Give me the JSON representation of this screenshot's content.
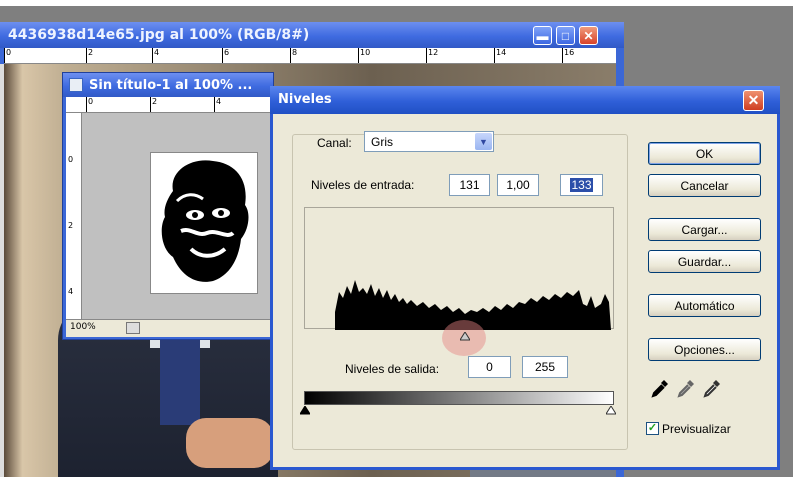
{
  "doc_main": {
    "title": "4436938d14e65.jpg al 100% (RGB/8#)",
    "ruler_ticks": [
      "0",
      "2",
      "4",
      "6",
      "8",
      "10",
      "12",
      "14",
      "16"
    ]
  },
  "doc_small": {
    "title": "Sin título-1 al 100% ...",
    "ruler_h_ticks": [
      "0",
      "2",
      "4"
    ],
    "ruler_v_ticks": [
      "0",
      "2",
      "4"
    ],
    "zoom": "100%"
  },
  "niveles": {
    "title": "Niveles",
    "close_glyph": "✕",
    "canal_label": "Canal:",
    "canal_value": "Gris",
    "entrada_label": "Niveles de entrada:",
    "entrada_black": "131",
    "entrada_gamma": "1,00",
    "entrada_white": "133",
    "salida_label": "Niveles de salida:",
    "salida_black": "0",
    "salida_white": "255",
    "buttons": {
      "ok": "OK",
      "cancelar": "Cancelar",
      "cargar": "Cargar...",
      "guardar": "Guardar...",
      "automatico": "Automático",
      "opciones": "Opciones..."
    },
    "preview_label": "Previsualizar",
    "preview_checked": true,
    "accent_color": "#2a58d0"
  },
  "icons": {
    "dropper_black": "black-eyedropper-icon",
    "dropper_gray": "gray-eyedropper-icon",
    "dropper_white": "white-eyedropper-icon"
  }
}
